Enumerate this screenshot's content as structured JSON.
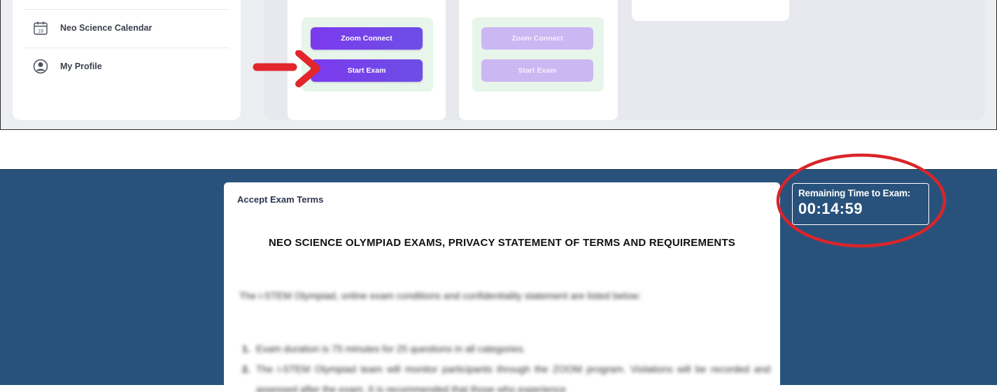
{
  "sidebar": {
    "items": [
      {
        "label": "Neo Science Calendar",
        "icon": "calendar-icon",
        "icon_text": "19"
      },
      {
        "label": "My Profile",
        "icon": "user-circle-icon"
      }
    ]
  },
  "exam_cards": [
    {
      "zoom_label": "Zoom Connect",
      "start_label": "Start Exam",
      "state": "active"
    },
    {
      "zoom_label": "Zoom Connect",
      "start_label": "Start Exam",
      "state": "disabled"
    }
  ],
  "annotation": {
    "arrow_color": "#e3262b",
    "highlight_color": "#d9252a"
  },
  "terms": {
    "header": "Accept Exam Terms",
    "title": "NEO SCIENCE OLYMPIAD EXAMS, PRIVACY STATEMENT OF TERMS AND REQUIREMENTS",
    "intro": "The i-STEM Olympiad, online exam conditions and confidentiality statement are listed below:",
    "items": [
      {
        "num": "1.",
        "text": "Exam duration is 75 minutes for 25 questions in all categories."
      },
      {
        "num": "2.",
        "text": "The i-STEM Olympiad team will monitor participants through the ZOOM program. Violations will be recorded and assessed after the exam. It is recommended that those who experience"
      }
    ]
  },
  "timer": {
    "label": "Remaining Time to Exam:",
    "value": "00:14:59"
  },
  "colors": {
    "primary_purple": "#7c3aed",
    "success_green": "#2ebd5a",
    "navy_background": "#28527c"
  }
}
